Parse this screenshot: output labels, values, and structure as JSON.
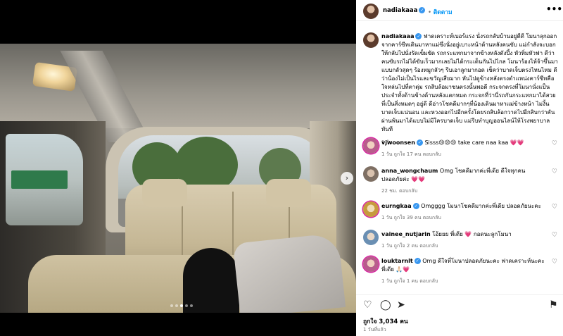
{
  "post": {
    "username": "nadiakaaa",
    "follow_label": "ติดตาม",
    "more_label": "•••",
    "caption": "ฟาดเคราะห์เบอร์แรง นั่งรถกลับบ้านอยู่ดีดี โมนาลุกออกจากคาร์ซีทเดินมาหาแม่ซึ่งนั่งอยู่เบาะหน้าด้านหลังคนขับ แม่กำลังจะบอกให้กลับไปนั่งรัดเข็มขัด รถกระแทกมาจากข้างหลังดังปึ้ง หัวทิ่มหัวฟา ดีว่าคนขับรถไม่ได้ขับเร็วมากเลยไม่ได้กระเด็นกันไปไกล โมนาร้องไห้จ้าขึ้นมาแบบกลัวสุดๆ ร้องหมูกลัวๆ รีบเอาลูกมากอด เช็คว่าบาดเจ็บตรงไหนไหม ดีว่าน้องไม่เป็นไรและขวัญเสียมาก หันไปดูข้างหลังตรงตำแหน่งคาร์ซีทคือใจหล่นไปที่ตาตุ่ม รถสิบล้อมาชนตรงนั้นพอดี กระจกตรงที่โมนานั่งแป็นประจำทั้งด้านข้างด้านหลังแตกหมด กระจกที่ว่านี่รถกันกระแทกมาได้สวยที่เป็นสิ่งหมดๆ อยู่ดี ดีอ่าวโชคดีมากๆที่น้องเดินมาหาแม่ข้างหน้า ไม่งั้นบาดเจ็บแน่นอน และหวงออกไปอีกครั้งโดยรถสิบล้อกวาดไปอีกสิบกว่าคัน ผ่านพ้นมาได้แบบไม่มีใครบาดเจ็บ แม่รีบทำบุญออนไลน์ให้โรงพยาบาลทันที",
    "caption_time": "1 วัน"
  },
  "comments": [
    {
      "user": "vjwoonsen",
      "verified": true,
      "text": "Sisss😢😢😢 take care naa kaa 💗💗",
      "time": "1 วัน",
      "likes": "ถูกใจ 17 คน",
      "reply": "ตอบกลับ"
    },
    {
      "user": "anna_wongchaum",
      "verified": false,
      "text": "Omg โชคดีมากค่ะพี่เดีย ดีใจทุกคนปลอดภัยค่ะ 💗💗",
      "time": "22 ชม.",
      "likes": "",
      "reply": "ตอบกลับ"
    },
    {
      "user": "eurngkaa",
      "verified": true,
      "text": "Omgggg โมนาโชคดีมากค่ะพี่เดีย ปลอดภัยนะคะ",
      "time": "1 วัน",
      "likes": "ถูกใจ 39 คน",
      "reply": "ตอบกลับ"
    },
    {
      "user": "vainee_nutjarin",
      "verified": false,
      "text": "โอ้ยยย พี่เดีย 💗 กอดนะลูกโมนา",
      "time": "1 วัน",
      "likes": "ถูกใจ 2 คน",
      "reply": "ตอบกลับ"
    },
    {
      "user": "louktarnlt",
      "verified": true,
      "text": "Omg ดีใจที่โมนาปลอดภัยนะคะ ฟาดเคราะห์นะคะพี่เดีย 🙏🏻💗",
      "time": "1 วัน",
      "likes": "ถูกใจ 1 คน",
      "reply": "ตอบกลับ"
    }
  ],
  "footer": {
    "likes": "ถูกใจ 3,034 คน",
    "ago": "1 วันที่แล้ว"
  },
  "photo": {
    "sign_text": "",
    "dots": [
      false,
      false,
      true,
      false,
      false
    ]
  },
  "icons": {
    "verified": "verified-badge",
    "like": "heart-icon",
    "comment": "comment-icon",
    "share": "share-icon",
    "save": "bookmark-icon",
    "next": "chevron-right-icon"
  },
  "glyphs": {
    "verified": "✓",
    "heart": "♡",
    "comment": "◯",
    "share": "➤",
    "save": "⚑",
    "next": "›"
  }
}
